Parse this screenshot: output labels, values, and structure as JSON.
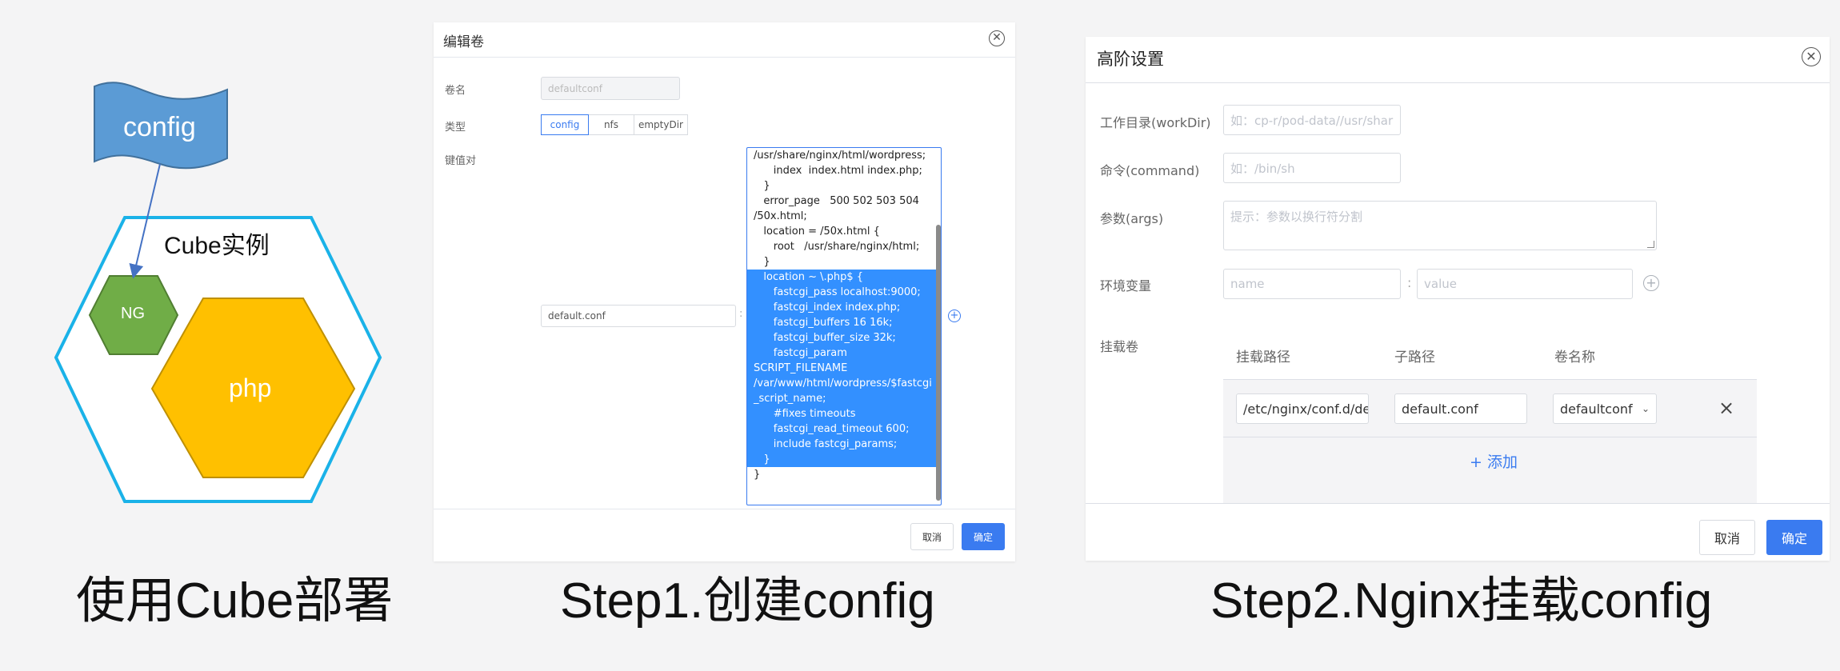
{
  "diagram": {
    "flag_label": "config",
    "instance_label": "Cube实例",
    "ng_label": "NG",
    "php_label": "php",
    "colors": {
      "flag": "#5b9bd5",
      "outer_hex": "#1ab2e8",
      "ng": "#70ad47",
      "php": "#ffc000"
    }
  },
  "captions": {
    "left": "使用Cube部署",
    "middle": "Step1.创建config",
    "right": "Step2.Nginx挂载config"
  },
  "edit_volume": {
    "title": "编辑卷",
    "name_label": "卷名",
    "name_value": "defaultconf",
    "type_label": "类型",
    "types": [
      "config",
      "nfs",
      "emptyDir"
    ],
    "active_type": "config",
    "kv_label": "键值对",
    "key_value": "default.conf",
    "separator": ":",
    "code_lines": [
      {
        "text": "/usr/share/nginx/html/wordpress;",
        "selected": false
      },
      {
        "text": "      index  index.html index.php;",
        "selected": false
      },
      {
        "text": "   }",
        "selected": false
      },
      {
        "text": "   error_page   500 502 503 504",
        "selected": false
      },
      {
        "text": "/50x.html;",
        "selected": false
      },
      {
        "text": "   location = /50x.html {",
        "selected": false
      },
      {
        "text": "      root   /usr/share/nginx/html;",
        "selected": false
      },
      {
        "text": "   }",
        "selected": false
      },
      {
        "text": "   location ~ \\.php$ {",
        "selected": true
      },
      {
        "text": "      fastcgi_pass localhost:9000;",
        "selected": true
      },
      {
        "text": "      fastcgi_index index.php;",
        "selected": true
      },
      {
        "text": "      fastcgi_buffers 16 16k;",
        "selected": true
      },
      {
        "text": "      fastcgi_buffer_size 32k;",
        "selected": true
      },
      {
        "text": "      fastcgi_param ",
        "selected": true
      },
      {
        "text": "SCRIPT_FILENAME ",
        "selected": true
      },
      {
        "text": "/var/www/html/wordpress/$fastcgi",
        "selected": true
      },
      {
        "text": "_script_name;",
        "selected": true
      },
      {
        "text": "      #fixes timeouts",
        "selected": true
      },
      {
        "text": "      fastcgi_read_timeout 600;",
        "selected": true
      },
      {
        "text": "      include fastcgi_params;",
        "selected": true
      },
      {
        "text": "   }",
        "selected": true
      },
      {
        "text": "}",
        "selected": false
      }
    ],
    "cancel_label": "取消",
    "confirm_label": "确定"
  },
  "advanced": {
    "title": "高阶设置",
    "workdir_label": "工作目录(workDir)",
    "workdir_placeholder": "如：cp-r/pod-data//usr/shar",
    "command_label": "命令(command)",
    "command_placeholder": "如：/bin/sh",
    "args_label": "参数(args)",
    "args_placeholder": "提示：参数以换行符分割",
    "env_label": "环境变量",
    "env_name_placeholder": "name",
    "env_value_placeholder": "value",
    "env_separator": ":",
    "mount_label": "挂载卷",
    "mount_headers": [
      "挂载路径",
      "子路径",
      "卷名称"
    ],
    "mount_row": {
      "path": "/etc/nginx/conf.d/de",
      "subpath": "default.conf",
      "volume": "defaultconf"
    },
    "add_label": "+ 添加",
    "cancel_label": "取消",
    "confirm_label": "确定"
  }
}
